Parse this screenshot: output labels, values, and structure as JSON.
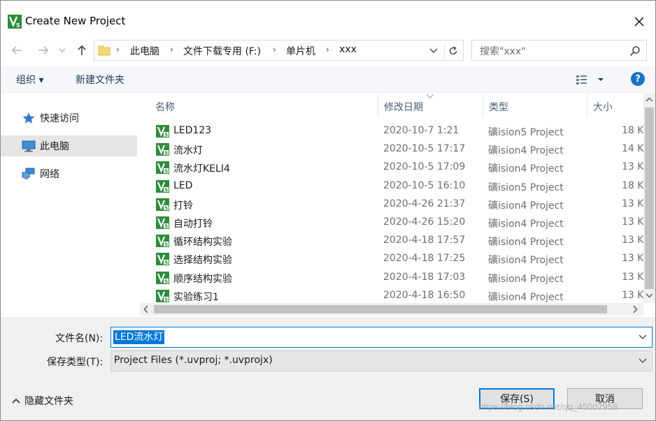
{
  "window": {
    "title": "Create New Project"
  },
  "address_bar": {
    "breadcrumbs": [
      "此电脑",
      "文件下载专用 (F:)",
      "单片机",
      "xxx"
    ]
  },
  "search": {
    "placeholder": "搜索\"xxx\""
  },
  "toolbar": {
    "organize_label": "组织 ▾",
    "new_folder_label": "新建文件夹",
    "help_label": "?"
  },
  "nav_pane": {
    "items": [
      {
        "label": "快速访问",
        "icon": "star-icon"
      },
      {
        "label": "此电脑",
        "icon": "computer-icon",
        "selected": true
      },
      {
        "label": "网络",
        "icon": "network-icon"
      }
    ]
  },
  "file_list": {
    "columns": [
      "名称",
      "修改日期",
      "类型",
      "大小"
    ],
    "rows": [
      {
        "name": "LED123",
        "date": "2020-10-7 1:21",
        "type": "礦ision5 Project",
        "size": "18 K"
      },
      {
        "name": "流水灯",
        "date": "2020-10-5 17:17",
        "type": "礦ision4 Project",
        "size": "14 K"
      },
      {
        "name": "流水灯KELI4",
        "date": "2020-10-5 17:09",
        "type": "礦ision4 Project",
        "size": "13 K"
      },
      {
        "name": "LED",
        "date": "2020-10-5 16:10",
        "type": "礦ision5 Project",
        "size": "18 K"
      },
      {
        "name": "打铃",
        "date": "2020-4-26 21:37",
        "type": "礦ision4 Project",
        "size": "13 K"
      },
      {
        "name": "自动打铃",
        "date": "2020-4-26 15:20",
        "type": "礦ision4 Project",
        "size": "13 K"
      },
      {
        "name": "循环结构实验",
        "date": "2020-4-18 17:57",
        "type": "礦ision4 Project",
        "size": "13 K"
      },
      {
        "name": "选择结构实验",
        "date": "2020-4-18 17:25",
        "type": "礦ision4 Project",
        "size": "13 K"
      },
      {
        "name": "顺序结构实验",
        "date": "2020-4-18 17:03",
        "type": "礦ision4 Project",
        "size": "13 K"
      },
      {
        "name": "实验练习1",
        "date": "2020-4-18 16:50",
        "type": "礦ision4 Project",
        "size": "13 K"
      }
    ]
  },
  "form": {
    "filename_label": "文件名(N):",
    "filename_value": "LED流水灯",
    "filetype_label": "保存类型(T):",
    "filetype_value": "Project Files (*.uvproj; *.uvprojx)",
    "hide_folders_label": "隐藏文件夹",
    "save_label": "保存(S)",
    "cancel_label": "取消"
  },
  "watermark": "https://blog.csdn.net/qq_45007958",
  "colors": {
    "accent": "#0078d7",
    "toolbar_text": "#1e395b",
    "help_blue": "#1a73c8",
    "keil_green": "#2e8b3a"
  }
}
